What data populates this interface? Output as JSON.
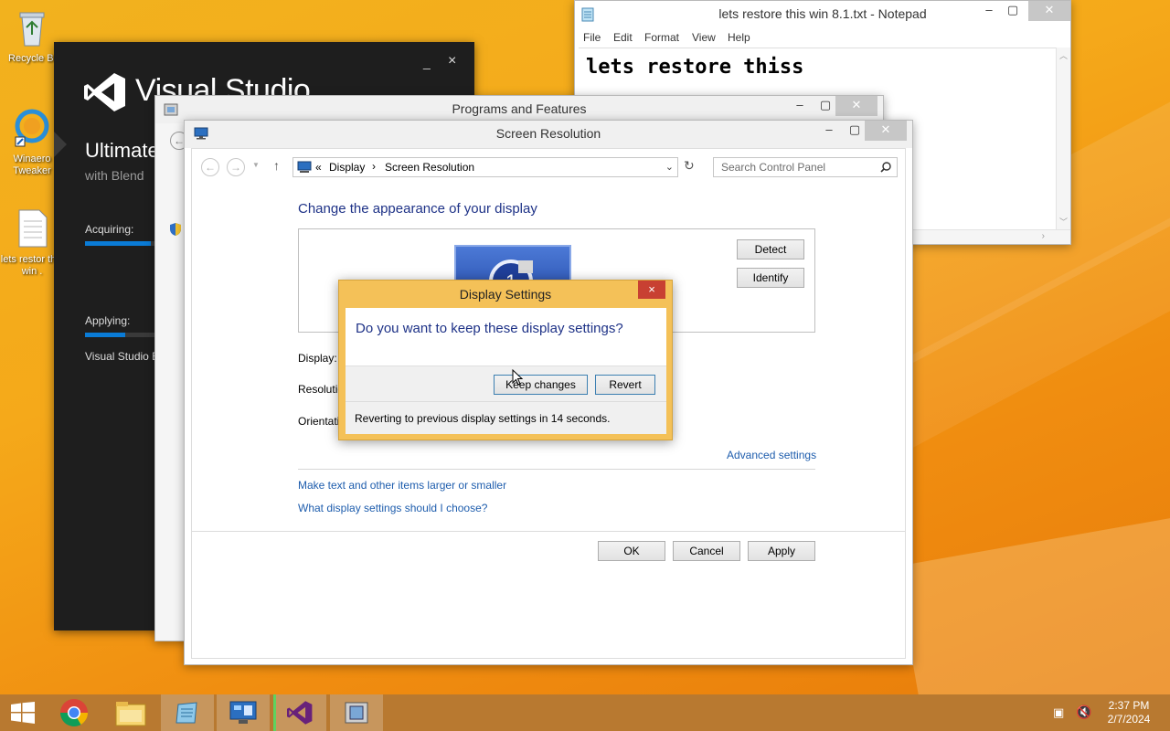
{
  "desktop": {
    "icons": [
      {
        "label": "Recycle Bi"
      },
      {
        "label": "Winaero Tweaker"
      },
      {
        "label": "lets restor this win ."
      }
    ]
  },
  "vs_installer": {
    "logo_text": "Visual Studio",
    "edition": "Ultimate",
    "subtitle": "with Blend",
    "acquiring_label": "Acquiring:",
    "applying_label": "Applying:",
    "status_text": "Visual Studio E",
    "acquiring_progress": 0.9,
    "applying_progress": 0.55,
    "minimize": "_",
    "close": "×"
  },
  "programs_features": {
    "title": "Programs and Features"
  },
  "notepad": {
    "title": "lets restore this win 8.1.txt - Notepad",
    "menu": [
      "File",
      "Edit",
      "Format",
      "View",
      "Help"
    ],
    "content": "lets restore thiss"
  },
  "screen_resolution": {
    "title": "Screen Resolution",
    "breadcrumb": {
      "sep": "«",
      "item1": "Display",
      "arrow": "›",
      "item2": "Screen Resolution"
    },
    "search_placeholder": "Search Control Panel",
    "heading": "Change the appearance of your display",
    "detect_label": "Detect",
    "identify_label": "Identify",
    "monitor_number": "1",
    "display_label": "Display:",
    "resolution_label": "Resolutio",
    "orientation_label": "Orientati",
    "advanced_link": "Advanced settings",
    "link_text_size": "Make text and other items larger or smaller",
    "link_choose": "What display settings should I choose?",
    "ok_label": "OK",
    "cancel_label": "Cancel",
    "apply_label": "Apply"
  },
  "dialog": {
    "title": "Display Settings",
    "question": "Do you want to keep these display settings?",
    "keep_label": "Keep changes",
    "revert_label": "Revert",
    "countdown_text": "Reverting to previous display settings in 14 seconds.",
    "close": "×"
  },
  "taskbar": {
    "time": "2:37 PM",
    "date": "2/7/2024"
  },
  "colors": {
    "accent_blue": "#1e3287",
    "link_blue": "#1e5dad",
    "dialog_frame": "#f4c158",
    "close_red": "#c84032"
  }
}
